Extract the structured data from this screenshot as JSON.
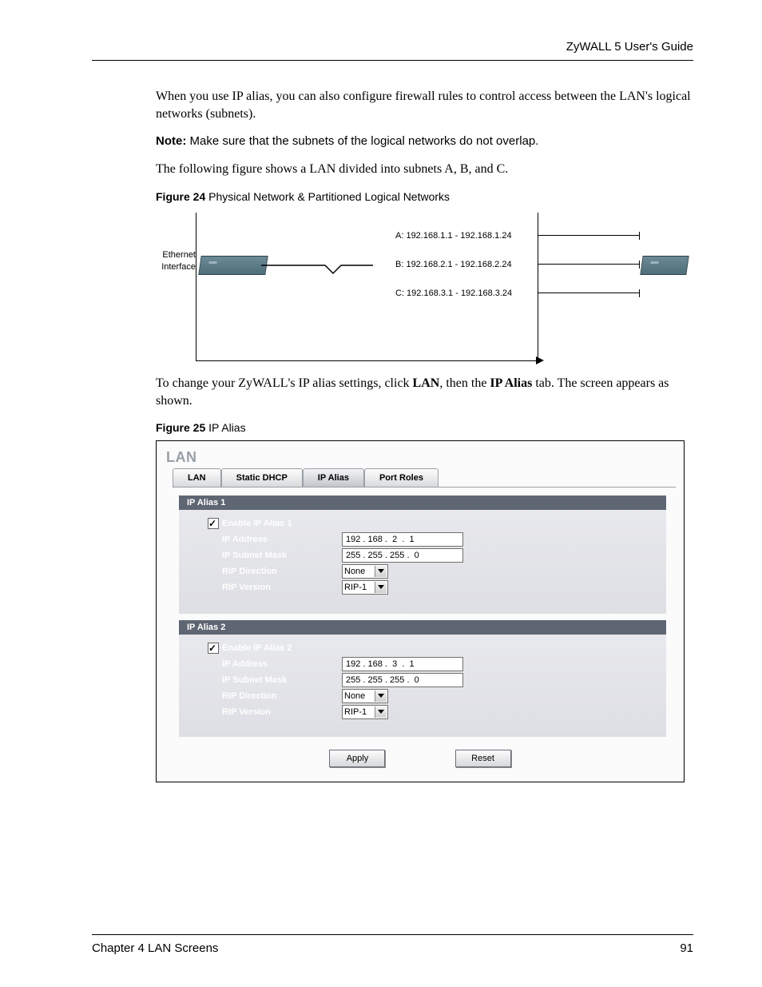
{
  "header": {
    "guide_title": "ZyWALL 5 User's Guide"
  },
  "paragraphs": {
    "p1": "When you use IP alias, you can also configure firewall rules to control access between the LAN's logical networks (subnets).",
    "note_prefix": "Note:",
    "note_body": " Make sure that the subnets of the logical networks do not overlap.",
    "p2": "The following figure shows a LAN divided into subnets A, B, and C.",
    "p3a": "To change your ZyWALL's IP alias settings, click ",
    "p3b": "LAN",
    "p3c": ", then the ",
    "p3d": "IP Alias",
    "p3e": " tab. The screen appears as shown."
  },
  "fig24": {
    "caption_label": "Figure 24",
    "caption_text": "   Physical Network & Partitioned Logical Networks",
    "ethernet_label": "Ethernet\nInterface",
    "subnet_a": "A: 192.168.1.1 - 192.168.1.24",
    "subnet_b": "B: 192.168.2.1 - 192.168.2.24",
    "subnet_c": "C: 192.168.3.1 - 192.168.3.24"
  },
  "fig25": {
    "caption_label": "Figure 25",
    "caption_text": "   IP Alias",
    "panel_title": "LAN",
    "tabs": [
      "LAN",
      "Static DHCP",
      "IP Alias",
      "Port Roles"
    ],
    "active_tab_index": 2,
    "alias1": {
      "header": "IP Alias 1",
      "enable_label": "Enable IP Alias 1",
      "ip_address_label": "IP Address",
      "ip_address_value": "192 . 168 .  2  .  1",
      "subnet_label": "IP Subnet Mask",
      "subnet_value": "255 . 255 . 255 .  0",
      "rip_dir_label": "RIP Direction",
      "rip_dir_value": "None",
      "rip_ver_label": "RIP Version",
      "rip_ver_value": "RIP-1"
    },
    "alias2": {
      "header": "IP Alias 2",
      "enable_label": "Enable IP Alias 2",
      "ip_address_label": "IP Address",
      "ip_address_value": "192 . 168 .  3  .  1",
      "subnet_label": "IP Subnet Mask",
      "subnet_value": "255 . 255 . 255 .  0",
      "rip_dir_label": "RIP Direction",
      "rip_dir_value": "None",
      "rip_ver_label": "RIP Version",
      "rip_ver_value": "RIP-1"
    },
    "buttons": {
      "apply": "Apply",
      "reset": "Reset"
    }
  },
  "footer": {
    "chapter": "Chapter 4 LAN Screens",
    "page": "91"
  }
}
